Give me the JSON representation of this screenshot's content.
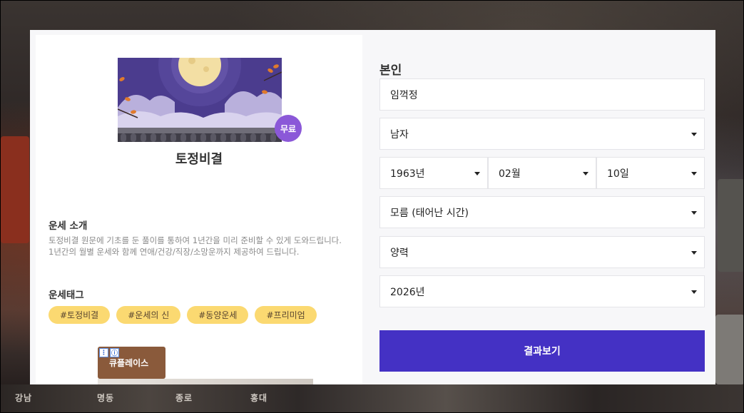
{
  "product": {
    "title": "토정비결",
    "badge": "무료"
  },
  "intro": {
    "heading": "운세 소개",
    "line1": "토정비결 원문에 기초를 둔 풀이를 통하여 1년간을 미리 준비할 수 있게 도와드립니다.",
    "line2": "1년간의 월별 운세와 함께 연애/건강/직장/소망운까지 제공하여 드립니다."
  },
  "tags": {
    "heading": "운세태그",
    "items": [
      "#토정비결",
      "#운세의 신",
      "#동양운세",
      "#프리미엄"
    ]
  },
  "ad": {
    "label": "큐플레이스"
  },
  "form": {
    "section_title": "본인",
    "name_value": "임꺽정",
    "gender": "남자",
    "birth_year": "1963년",
    "birth_month": "02월",
    "birth_day": "10일",
    "birth_time": "모름 (태어난 시간)",
    "calendar": "양력",
    "target_year": "2026년",
    "submit_label": "결과보기"
  },
  "background_signs": [
    "강남",
    "명동",
    "종로",
    "홍대"
  ],
  "colors": {
    "submit": "#4431c4",
    "badge": "#8b58d8",
    "tag_bg": "#fbd971"
  }
}
